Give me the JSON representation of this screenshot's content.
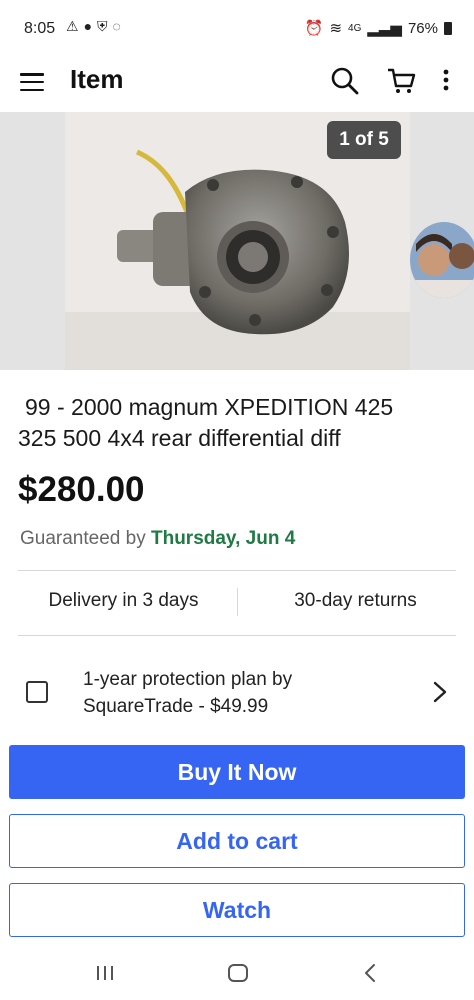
{
  "status_bar": {
    "time": "8:05",
    "signal": "4G",
    "battery": "76%"
  },
  "header": {
    "title": "Item"
  },
  "gallery": {
    "counter": "1 of 5"
  },
  "listing": {
    "title_line1": "99 - 2000 magnum XPEDITION 425",
    "title_line2": "325 500 4x4 rear differential  diff",
    "price": "$280.00",
    "guarantee_prefix": "Guaranteed by",
    "guarantee_date": "Thursday, Jun 4",
    "delivery": "Delivery in 3 days",
    "returns": "30-day returns",
    "protection_line1": "1-year protection plan by",
    "protection_line2": "SquareTrade - $49.99"
  },
  "actions": {
    "buy_now": "Buy It Now",
    "add_to_cart": "Add to cart",
    "watch": "Watch"
  },
  "colors": {
    "primary": "#3665f3",
    "guarantee_date": "#1f7a45"
  },
  "icons": [
    "menu-icon",
    "search-icon",
    "cart-icon",
    "more-vertical-icon",
    "chevron-right-icon",
    "recent-apps-icon",
    "home-icon",
    "back-icon"
  ]
}
